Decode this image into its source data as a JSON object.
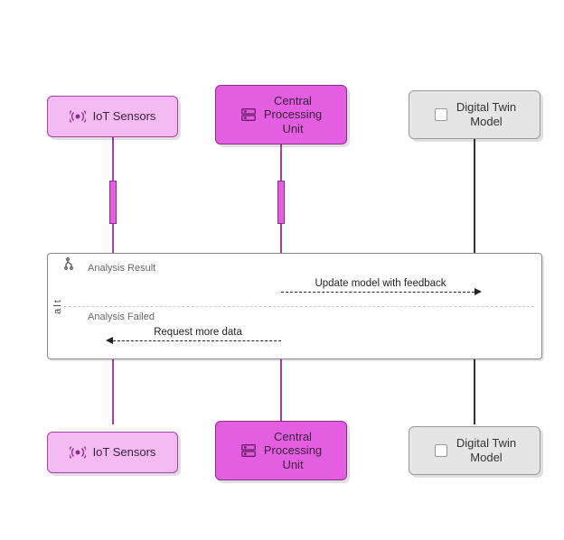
{
  "actors": {
    "sensors": {
      "label": "IoT Sensors",
      "icon": "signal-icon"
    },
    "cpu": {
      "label": "Central\nProcessing\nUnit",
      "icon": "server-icon"
    },
    "twin": {
      "label": "Digital Twin\nModel",
      "icon": "square-icon"
    }
  },
  "alt": {
    "tag": "alt",
    "branch1": {
      "condition": "Analysis Result",
      "message": "Update model with feedback"
    },
    "branch2": {
      "condition": "Analysis Failed",
      "message": "Request more data"
    }
  }
}
